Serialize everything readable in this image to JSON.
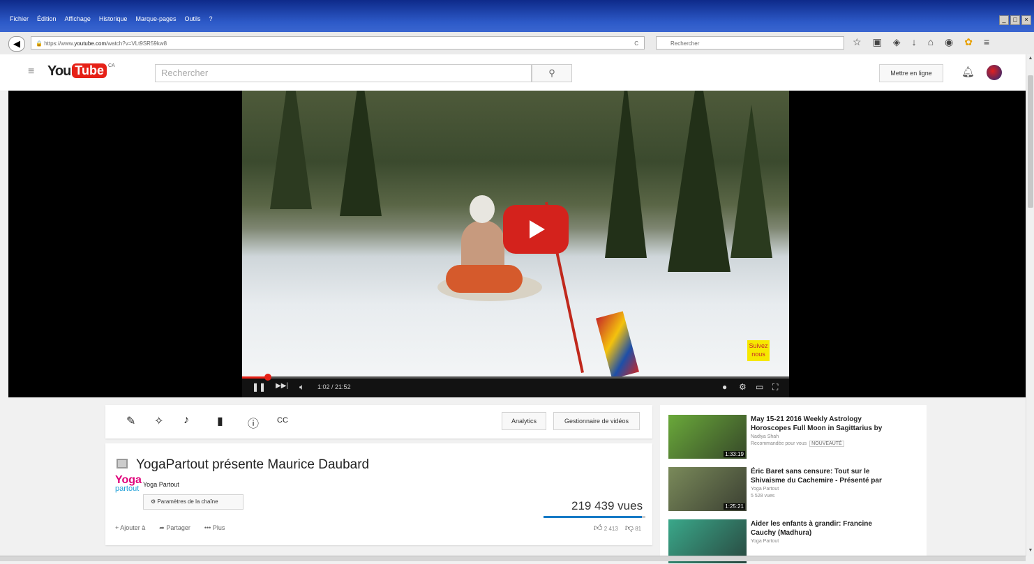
{
  "browser": {
    "menus": [
      "Fichier",
      "Édition",
      "Affichage",
      "Historique",
      "Marque-pages",
      "Outils",
      "?"
    ],
    "window_controls": [
      "_",
      "□",
      "×"
    ],
    "url_prefix": "https://www.",
    "url_host": "youtube.com",
    "url_path": "/watch?v=VLt9SR59kw8",
    "search_placeholder": "Rechercher",
    "toolbar_icons": [
      "star-icon",
      "bookmarks-icon",
      "pocket-icon",
      "download-icon",
      "home-icon",
      "chat-icon",
      "addon-icon",
      "menu-icon"
    ]
  },
  "youtube": {
    "logo_you": "You",
    "logo_tube": "Tube",
    "country": "CA",
    "search_placeholder": "Rechercher",
    "upload_label": "Mettre en ligne"
  },
  "player": {
    "overlay_text": "Suivez nous",
    "time_current": "1:02",
    "time_total": "21:52",
    "progress": 0.047
  },
  "toolbar": {
    "analytics_label": "Analytics",
    "manager_label": "Gestionnaire de vidéos"
  },
  "video": {
    "title": "YogaPartout présente Maurice Daubard",
    "channel_name": "Yoga Partout",
    "channel_logo_top": "Yoga",
    "channel_logo_bottom": "partout",
    "channel_settings_label": "Paramètres de la chaîne",
    "views": "219 439 vues",
    "likes": "2 413",
    "dislikes": "81",
    "like_ratio": 0.967,
    "actions": [
      {
        "icon": "+",
        "label": "Ajouter à"
      },
      {
        "icon": "➦",
        "label": "Partager"
      },
      {
        "icon": "•••",
        "label": "Plus"
      }
    ]
  },
  "recommendations": [
    {
      "title": "May 15-21 2016 Weekly Astrology Horoscopes Full Moon in Sagittarius by",
      "channel": "Nadiya Shah",
      "meta": "Recommandée pour vous",
      "badge": "NOUVEAUTÉ",
      "duration": "1:33:19",
      "color": "#6aa93a"
    },
    {
      "title": "Éric Baret sans censure: Tout sur le Shivaisme du Cachemire - Présenté par",
      "channel": "Yoga Partout",
      "meta": "5 528 vues",
      "badge": "",
      "duration": "1:25:21",
      "color": "#7a8a5a"
    },
    {
      "title": "Aider les enfants à grandir: Francine Cauchy (Madhura)",
      "channel": "Yoga Partout",
      "meta": "",
      "badge": "",
      "duration": "",
      "color": "#3aa88a"
    }
  ]
}
